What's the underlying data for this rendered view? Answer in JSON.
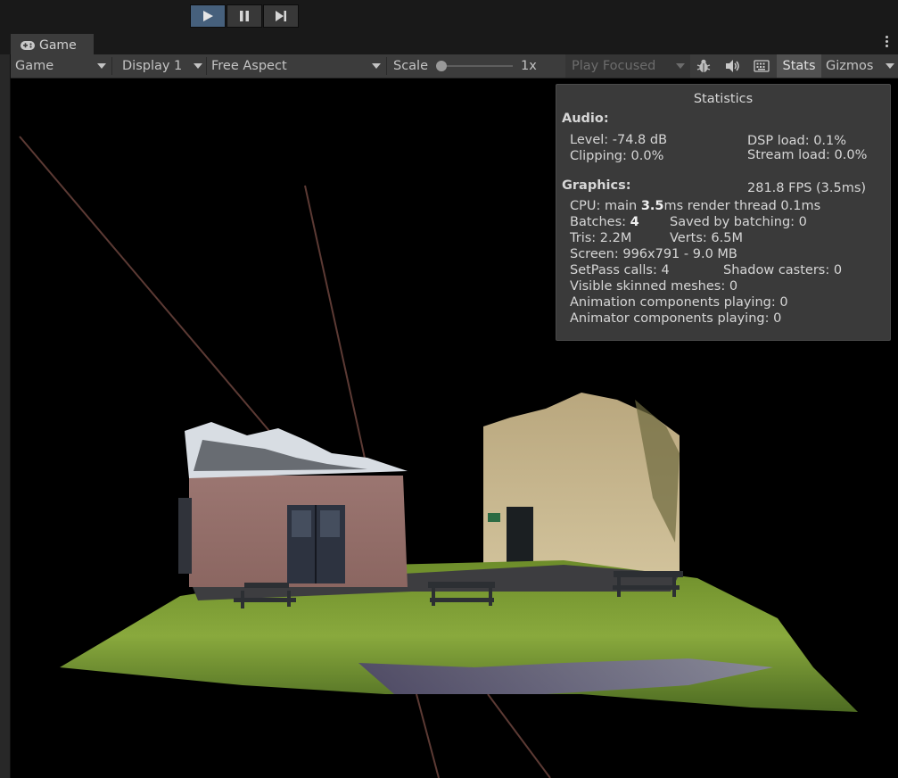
{
  "toolbar": {
    "play_icon": "play-icon",
    "pause_icon": "pause-icon",
    "step_icon": "step-icon",
    "accent": "#46607c"
  },
  "tab": {
    "label": "Game",
    "icon": "gamepad-icon"
  },
  "controls": {
    "view_dropdown": "Game",
    "display_dropdown": "Display 1",
    "aspect_dropdown": "Free Aspect",
    "scale_label": "Scale",
    "scale_value": "1x",
    "play_focused": "Play Focused",
    "stats_button": "Stats",
    "gizmos_button": "Gizmos"
  },
  "stats": {
    "title": "Statistics",
    "audio_header": "Audio:",
    "level": "Level: -74.8 dB",
    "clipping": "Clipping: 0.0%",
    "dsp_load": "DSP load: 0.1%",
    "stream_load": "Stream load: 0.0%",
    "graphics_header": "Graphics:",
    "fps": "281.8 FPS (3.5ms)",
    "cpu_prefix": "CPU: main ",
    "cpu_main": "3.5",
    "cpu_suffix": "ms  render thread 0.1ms",
    "batches_prefix": "Batches: ",
    "batches_value": "4",
    "saved_by_batching": "Saved by batching: 0",
    "tris": "Tris: 2.2M",
    "verts": "Verts: 6.5M",
    "screen": "Screen: 996x791 - 9.0 MB",
    "setpass": "SetPass calls: 4",
    "shadow_casters": "Shadow casters: 0",
    "skinned_meshes": "Visible skinned meshes: 0",
    "animation_components": "Animation components playing: 0",
    "animator_components": "Animator components playing: 0"
  }
}
